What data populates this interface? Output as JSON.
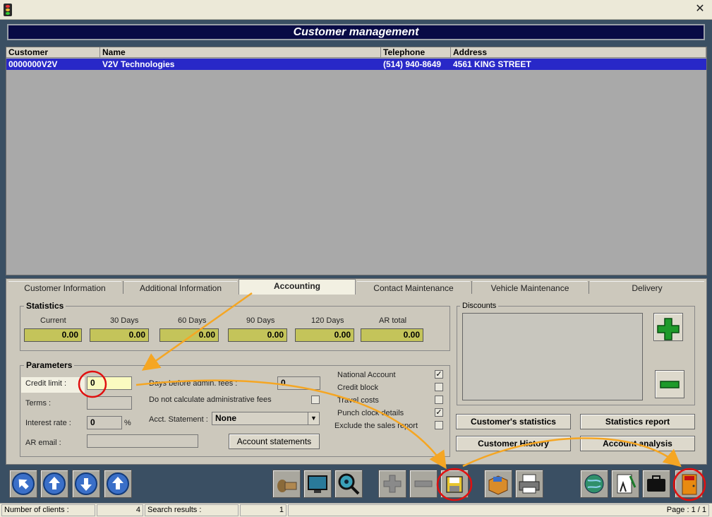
{
  "window": {
    "close_symbol": "✕"
  },
  "header": {
    "title": "Customer management"
  },
  "grid": {
    "columns": [
      "Customer",
      "Name",
      "Telephone",
      "Address"
    ],
    "rows": [
      {
        "customer": "0000000V2V",
        "name": "V2V Technologies",
        "telephone": "(514) 940-8649",
        "address": "4561 KING STREET"
      }
    ]
  },
  "tabs": [
    {
      "label": "Customer Information"
    },
    {
      "label": "Additional Information"
    },
    {
      "label": "Accounting"
    },
    {
      "label": "Contact Maintenance"
    },
    {
      "label": "Vehicle Maintenance"
    },
    {
      "label": "Delivery"
    }
  ],
  "statistics": {
    "legend": "Statistics",
    "items": [
      {
        "label": "Current",
        "value": "0.00"
      },
      {
        "label": "30 Days",
        "value": "0.00"
      },
      {
        "label": "60 Days",
        "value": "0.00"
      },
      {
        "label": "90 Days",
        "value": "0.00"
      },
      {
        "label": "120 Days",
        "value": "0.00"
      },
      {
        "label": "AR total",
        "value": "0.00"
      }
    ]
  },
  "parameters": {
    "legend": "Parameters",
    "credit_limit_label": "Credit limit :",
    "credit_limit_value": "0",
    "terms_label": "Terms :",
    "terms_value": "",
    "interest_label": "Interest rate :",
    "interest_value": "0",
    "percent": "%",
    "ar_email_label": "AR email :",
    "ar_email_value": "",
    "days_admin_label": "Days before admin. fees :",
    "days_admin_value": "0",
    "no_admin_fees_label": "Do not calculate administrative fees",
    "acct_statement_label": "Acct. Statement :",
    "acct_statement_value": "None",
    "account_statements_btn": "Account statements",
    "checks": [
      {
        "label": "National Account",
        "checked": true
      },
      {
        "label": "Credit block",
        "checked": false
      },
      {
        "label": "Travel costs",
        "checked": false
      },
      {
        "label": "Punch clock details",
        "checked": true
      },
      {
        "label": "Exclude the sales report",
        "checked": false
      }
    ]
  },
  "discounts": {
    "legend": "Discounts"
  },
  "buttons": {
    "customer_statistics": "Customer's statistics",
    "statistics_report": "Statistics report",
    "customer_history": "Customer History",
    "account_analysis": "Account analysis"
  },
  "status": {
    "clients_label": "Number of clients :",
    "clients_value": "4",
    "search_label": "Search results :",
    "search_value": "1",
    "page": "Page : 1 / 1"
  },
  "toolbar_icons": [
    "first-record-icon",
    "previous-record-icon",
    "next-record-icon",
    "last-record-icon",
    "stamp-icon",
    "monitor-icon",
    "search-icon",
    "add-icon",
    "remove-icon",
    "save-icon",
    "box-icon",
    "print-icon",
    "globe-icon",
    "edit-icon",
    "briefcase-icon",
    "exit-icon"
  ],
  "colors": {
    "header_bg": "#080a45",
    "selected_row": "#2828c8",
    "stat_field": "#c4c45a",
    "annotation": "#f5a623",
    "highlight_circle": "#e01010"
  }
}
